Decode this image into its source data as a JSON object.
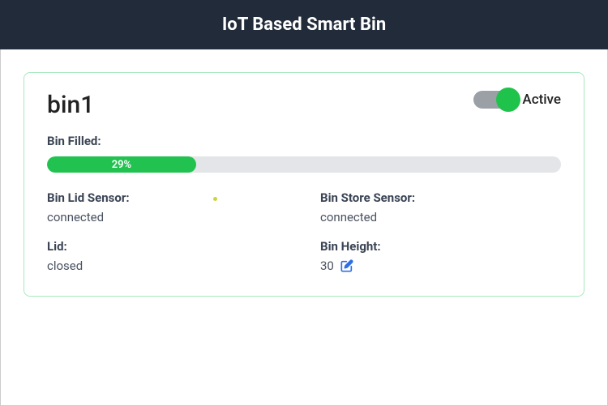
{
  "header": {
    "title": "IoT Based Smart Bin"
  },
  "bin": {
    "name": "bin1",
    "toggle": {
      "state": "on",
      "label": "Active"
    },
    "fill": {
      "label": "Bin Filled:",
      "percent_text": "29%",
      "percent_value": 29
    },
    "lid_sensor": {
      "label": "Bin Lid Sensor:",
      "value": "connected"
    },
    "store_sensor": {
      "label": "Bin Store Sensor:",
      "value": "connected"
    },
    "lid": {
      "label": "Lid:",
      "value": "closed"
    },
    "height": {
      "label": "Bin Height:",
      "value": "30"
    }
  }
}
